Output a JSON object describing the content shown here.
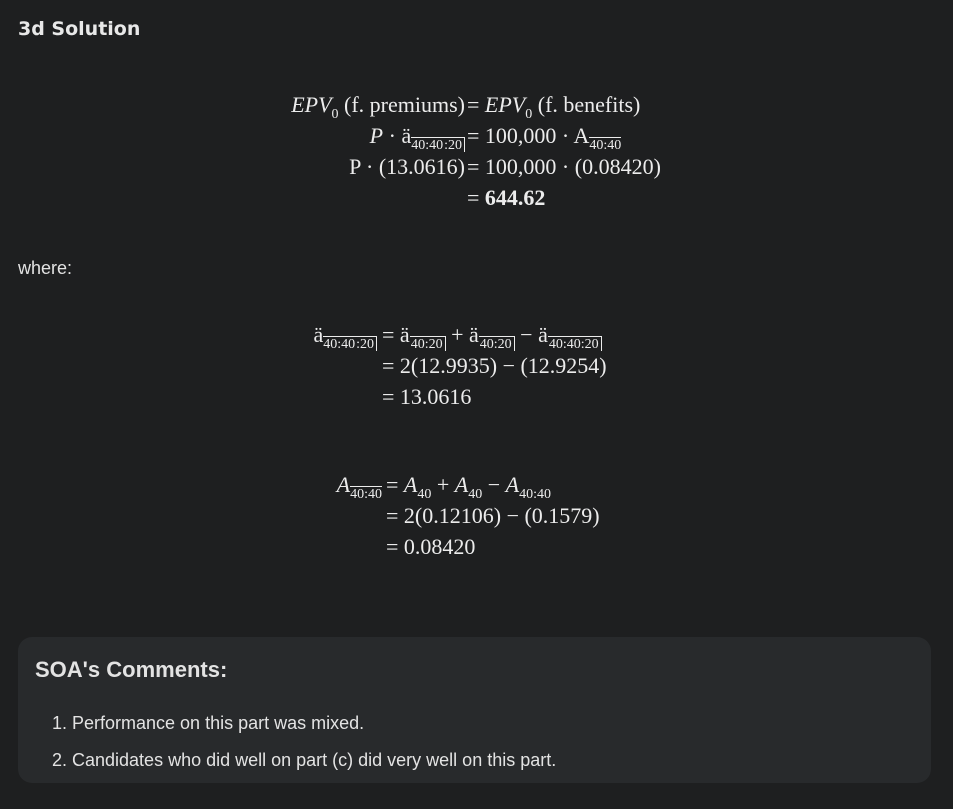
{
  "heading": "3d Solution",
  "eq1": {
    "row1_lhs": "EPV",
    "row1_lhs_sub": "0",
    "row1_lhs_arg": "(f. premiums)",
    "row1_rhs": "EPV",
    "row1_rhs_sub": "0",
    "row1_rhs_arg": "(f. benefits)",
    "row2_lhs_P": "P",
    "row2_lhs_dot": "·",
    "row2_lhs_a": "ä",
    "row2_lhs_sub_joint": "40:40",
    "row2_lhs_sub_term": ":20",
    "row2_rhs": "100,000 · A",
    "row2_rhs_sub": "40:40",
    "row3_lhs": "P · (13.0616)",
    "row3_rhs": "100,000 · (0.08420)",
    "row4_rhs": "644.62"
  },
  "where_label": "where:",
  "eq2": {
    "row1_lhs_a": "ä",
    "row1_lhs_sub_joint": "40:40",
    "row1_lhs_sub_term": ":20",
    "row1_t1_a": "ä",
    "row1_t1_sub": "40:20",
    "row1_plus": "+",
    "row1_t2_a": "ä",
    "row1_t2_sub": "40:20",
    "row1_minus": "−",
    "row1_t3_a": "ä",
    "row1_t3_sub": "40:40:20",
    "row2_rhs": "2(12.9935) − (12.9254)",
    "row3_rhs": "13.0616"
  },
  "eq3": {
    "row1_lhs_A": "A",
    "row1_lhs_sub": "40:40",
    "row1_rhs_A1": "A",
    "row1_rhs_sub1": "40",
    "row1_plus": "+",
    "row1_rhs_A2": "A",
    "row1_rhs_sub2": "40",
    "row1_minus": "−",
    "row1_rhs_A3": "A",
    "row1_rhs_sub3": "40:40",
    "row2_rhs": "2(0.12106) − (0.1579)",
    "row3_rhs": "0.08420"
  },
  "equals": "=",
  "comments": {
    "title": "SOA's Comments:",
    "items": [
      "Performance on this part was mixed.",
      "Candidates who did well on part (c) did very well on this part."
    ]
  }
}
